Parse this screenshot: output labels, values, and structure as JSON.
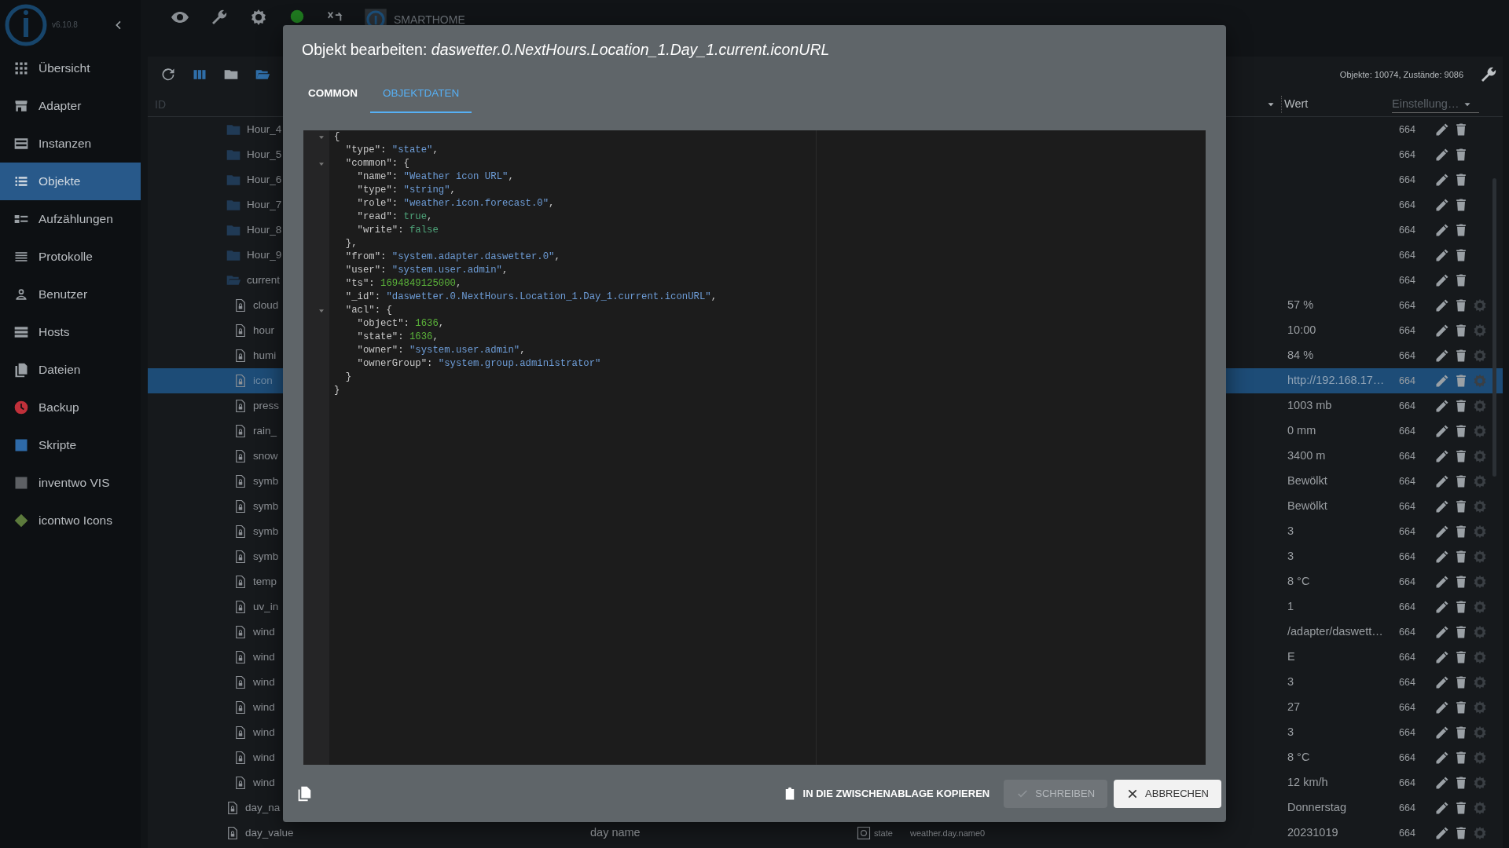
{
  "app": {
    "version": "v6.10.8",
    "brand": "SMARTHOME"
  },
  "sidebar": {
    "items": [
      {
        "label": "Übersicht",
        "selected": false
      },
      {
        "label": "Adapter",
        "selected": false
      },
      {
        "label": "Instanzen",
        "selected": false
      },
      {
        "label": "Objekte",
        "selected": true
      },
      {
        "label": "Aufzählungen",
        "selected": false
      },
      {
        "label": "Protokolle",
        "selected": false
      },
      {
        "label": "Benutzer",
        "selected": false
      },
      {
        "label": "Hosts",
        "selected": false
      },
      {
        "label": "Dateien",
        "selected": false
      },
      {
        "label": "Backup",
        "selected": false
      },
      {
        "label": "Skripte",
        "selected": false
      },
      {
        "label": "inventwo VIS",
        "selected": false
      },
      {
        "label": "icontwo Icons",
        "selected": false
      }
    ]
  },
  "objects": {
    "stats": "Objekte: 10074, Zustände: 9086",
    "columns": {
      "id": "ID",
      "value": "Wert",
      "settings": "Einstellung…"
    },
    "tree": [
      {
        "kind": "folder",
        "name": "Hour_4",
        "acl": "664",
        "expanded": false,
        "selected": false
      },
      {
        "kind": "folder",
        "name": "Hour_5",
        "acl": "664",
        "expanded": false,
        "selected": false
      },
      {
        "kind": "folder",
        "name": "Hour_6",
        "acl": "664",
        "expanded": false,
        "selected": false
      },
      {
        "kind": "folder",
        "name": "Hour_7",
        "acl": "664",
        "expanded": false,
        "selected": false
      },
      {
        "kind": "folder",
        "name": "Hour_8",
        "acl": "664",
        "expanded": false,
        "selected": false
      },
      {
        "kind": "folder",
        "name": "Hour_9",
        "acl": "664",
        "expanded": false,
        "selected": false
      },
      {
        "kind": "folder",
        "name": "current",
        "acl": "664",
        "expanded": true,
        "selected": false,
        "children": [
          {
            "kind": "state",
            "name": "cloud",
            "value": "57 %",
            "acl": "664",
            "selected": false
          },
          {
            "kind": "state",
            "name": "hour",
            "value": "10:00",
            "acl": "664",
            "selected": false
          },
          {
            "kind": "state",
            "name": "humi",
            "value": "84 %",
            "acl": "664",
            "selected": false
          },
          {
            "kind": "state",
            "name": "icon",
            "value": "http://192.168.17…",
            "acl": "664",
            "selected": true
          },
          {
            "kind": "state",
            "name": "press",
            "value": "1003 mb",
            "acl": "664",
            "selected": false
          },
          {
            "kind": "state",
            "name": "rain_",
            "value": "0 mm",
            "acl": "664",
            "selected": false
          },
          {
            "kind": "state",
            "name": "snow",
            "value": "3400 m",
            "acl": "664",
            "selected": false
          },
          {
            "kind": "state",
            "name": "symb",
            "value": "Bewölkt",
            "acl": "664",
            "selected": false
          },
          {
            "kind": "state",
            "name": "symb",
            "value": "Bewölkt",
            "acl": "664",
            "selected": false
          },
          {
            "kind": "state",
            "name": "symb",
            "value": "3",
            "acl": "664",
            "selected": false
          },
          {
            "kind": "state",
            "name": "symb",
            "value": "3",
            "acl": "664",
            "selected": false
          },
          {
            "kind": "state",
            "name": "temp",
            "value": "8 °C",
            "acl": "664",
            "selected": false
          },
          {
            "kind": "state",
            "name": "uv_in",
            "value": "1",
            "acl": "664",
            "selected": false
          },
          {
            "kind": "state",
            "name": "wind",
            "value": "/adapter/daswett…",
            "acl": "664",
            "selected": false
          },
          {
            "kind": "state",
            "name": "wind",
            "value": "E",
            "acl": "664",
            "selected": false
          },
          {
            "kind": "state",
            "name": "wind",
            "value": "3",
            "acl": "664",
            "selected": false
          },
          {
            "kind": "state",
            "name": "wind",
            "value": "27",
            "acl": "664",
            "selected": false
          },
          {
            "kind": "state",
            "name": "wind",
            "value": "3",
            "acl": "664",
            "selected": false
          },
          {
            "kind": "state",
            "name": "wind",
            "value": "8 °C",
            "acl": "664",
            "selected": false
          },
          {
            "kind": "state",
            "name": "wind",
            "value": "12 km/h",
            "acl": "664",
            "selected": false
          }
        ]
      },
      {
        "kind": "state",
        "name": "day_na",
        "value": "Donnerstag",
        "acl": "664",
        "selected": false
      },
      {
        "kind": "state",
        "name": "day_value",
        "description": "day name",
        "type": "state",
        "role": "weather.day.name0",
        "value": "20231019",
        "acl": "664",
        "selected": false
      }
    ]
  },
  "dialog": {
    "title": "Objekt bearbeiten: *daswetter.0.NextHours.Location_1.Day_1.current.iconURL*",
    "tabs": [
      {
        "label": "COMMON",
        "selected": false
      },
      {
        "label": "OBJEKTDATEN",
        "selected": true
      }
    ],
    "code": [
      {
        "text": "{",
        "foldable": true
      },
      {
        "text": "  \"type\": \"state\",",
        "foldable": false
      },
      {
        "text": "  \"common\": {",
        "foldable": true
      },
      {
        "text": "    \"name\": \"Weather icon URL\",",
        "foldable": false
      },
      {
        "text": "    \"type\": \"string\",",
        "foldable": false
      },
      {
        "text": "    \"role\": \"weather.icon.forecast.0\",",
        "foldable": false
      },
      {
        "text": "    \"read\": true,",
        "foldable": false
      },
      {
        "text": "    \"write\": false",
        "foldable": false
      },
      {
        "text": "  },",
        "foldable": false
      },
      {
        "text": "  \"from\": \"system.adapter.daswetter.0\",",
        "foldable": false
      },
      {
        "text": "  \"user\": \"system.user.admin\",",
        "foldable": false
      },
      {
        "text": "  \"ts\": 1694849125000,",
        "foldable": false
      },
      {
        "text": "  \"_id\": \"daswetter.0.NextHours.Location_1.Day_1.current.iconURL\",",
        "foldable": false
      },
      {
        "text": "  \"acl\": {",
        "foldable": true
      },
      {
        "text": "    \"object\": 1636,",
        "foldable": false
      },
      {
        "text": "    \"state\": 1636,",
        "foldable": false
      },
      {
        "text": "    \"owner\": \"system.user.admin\",",
        "foldable": false
      },
      {
        "text": "    \"ownerGroup\": \"system.group.administrator\"",
        "foldable": false
      },
      {
        "text": "  }",
        "foldable": false
      },
      {
        "text": "}",
        "foldable": false
      }
    ],
    "copy_label": "IN DIE ZWISCHENABLAGE KOPIEREN",
    "buttons": [
      {
        "kind": "save",
        "label": "SCHREIBEN",
        "disabled": true
      },
      {
        "kind": "cancel",
        "label": "ABBRECHEN",
        "disabled": false
      }
    ]
  }
}
